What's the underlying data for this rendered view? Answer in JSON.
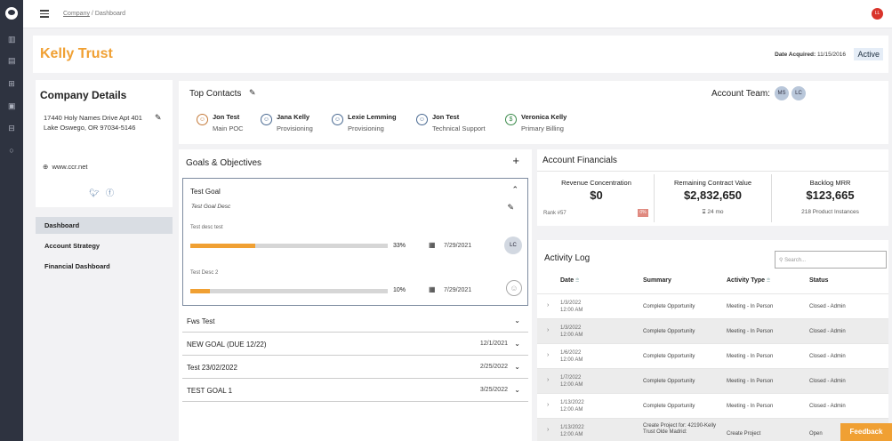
{
  "breadcrumb": {
    "company": "Company",
    "sep": "/",
    "current": "Dashboard"
  },
  "user_initials": "LL",
  "header": {
    "title": "Kelly Trust",
    "acquired_label": "Date Acquired:",
    "acquired_value": "11/15/2016",
    "status": "Active"
  },
  "company_details": {
    "title": "Company Details",
    "address": "17440 Holy Names Drive Apt 401",
    "city": "Lake Oswego, OR 97034-5146",
    "website": "www.ccr.net"
  },
  "nav": [
    "Dashboard",
    "Account Strategy",
    "Financial Dashboard"
  ],
  "top_contacts": {
    "title": "Top Contacts",
    "account_team_label": "Account Team:",
    "team": [
      "MS",
      "LC"
    ],
    "contacts": [
      {
        "name": "Jon Test",
        "role": "Main POC"
      },
      {
        "name": "Jana Kelly",
        "role": "Provisioning"
      },
      {
        "name": "Lexie Lemming",
        "role": "Provisioning"
      },
      {
        "name": "Jon Test",
        "role": "Technical Support"
      },
      {
        "name": "Veronica Kelly",
        "role": "Primary Billing"
      }
    ]
  },
  "goals": {
    "title": "Goals & Objectives",
    "expanded": {
      "name": "Test Goal",
      "desc": "Test Goal Desc",
      "subs": [
        {
          "label": "Test desc test",
          "progress": 33,
          "pct": "33%",
          "date": "7/29/2021",
          "owner": "LC"
        },
        {
          "label": "Test Desc 2",
          "progress": 10,
          "pct": "10%",
          "date": "7/29/2021",
          "owner": ""
        }
      ]
    },
    "rows": [
      {
        "name": "Fws Test",
        "date": ""
      },
      {
        "name": "NEW GOAL (DUE 12/22)",
        "date": "12/1/2021"
      },
      {
        "name": "Test 23/02/2022",
        "date": "2/25/2022"
      },
      {
        "name": "TEST GOAL 1",
        "date": "3/25/2022"
      }
    ]
  },
  "financials": {
    "title": "Account Financials",
    "metrics": [
      {
        "label": "Revenue Concentration",
        "value": "$0",
        "sub": ""
      },
      {
        "label": "Remaining Contract Value",
        "value": "$2,832,650",
        "sub": "24 mo"
      },
      {
        "label": "Backlog MRR",
        "value": "$123,665",
        "sub": "218 Product Instances"
      }
    ],
    "rank": "Rank #57",
    "rank_badge": "0%"
  },
  "activity": {
    "title": "Activity Log",
    "search_placeholder": "Search...",
    "columns": [
      "Date",
      "Summary",
      "Activity Type",
      "Status"
    ],
    "rows": [
      {
        "date": "1/3/2022",
        "time": "12:00 AM",
        "summary": "Complete Opportunity",
        "type": "Meeting - In Person",
        "status": "Closed - Admin"
      },
      {
        "date": "1/3/2022",
        "time": "12:00 AM",
        "summary": "Complete Opportunity",
        "type": "Meeting - In Person",
        "status": "Closed - Admin"
      },
      {
        "date": "1/6/2022",
        "time": "12:00 AM",
        "summary": "Complete Opportunity",
        "type": "Meeting - In Person",
        "status": "Closed - Admin"
      },
      {
        "date": "1/7/2022",
        "time": "12:00 AM",
        "summary": "Complete Opportunity",
        "type": "Meeting - In Person",
        "status": "Closed - Admin"
      },
      {
        "date": "1/13/2022",
        "time": "12:00 AM",
        "summary": "Complete Opportunity",
        "type": "Meeting - In Person",
        "status": "Closed - Admin"
      },
      {
        "date": "1/13/2022",
        "time": "12:00 AM",
        "summary": "Create Project for: 42190-Kelly Trust Olde Madrid:",
        "type": "Create Project",
        "status": "Open"
      }
    ]
  },
  "feedback": "Feedback",
  "colors": {
    "accent": "#f0a033",
    "rail": "#2e3340"
  }
}
